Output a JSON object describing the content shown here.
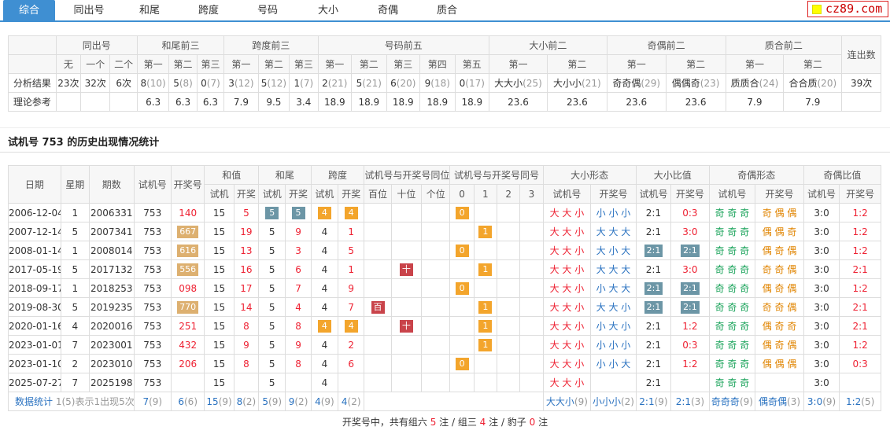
{
  "nav": {
    "tabs": [
      "综合",
      "同出号",
      "和尾",
      "跨度",
      "号码",
      "大小",
      "奇偶",
      "质合"
    ],
    "active": 0
  },
  "logo": "cz89.com",
  "top": {
    "groups": [
      "同出号",
      "和尾前三",
      "跨度前三",
      "号码前五",
      "大小前二",
      "奇偶前二",
      "质合前二",
      "连出数"
    ],
    "subheads": [
      "无",
      "一个",
      "二个",
      "第一",
      "第二",
      "第三",
      "第一",
      "第二",
      "第三",
      "第一",
      "第二",
      "第三",
      "第四",
      "第五",
      "第一",
      "第二",
      "第一",
      "第二",
      "第一",
      "第二"
    ],
    "row1_label": "分析结果",
    "row1": [
      [
        "23次",
        ""
      ],
      [
        "32次",
        ""
      ],
      [
        "6次",
        ""
      ],
      [
        "8",
        "(10)"
      ],
      [
        "5",
        "(8)"
      ],
      [
        "0",
        "(7)"
      ],
      [
        "3",
        "(12)"
      ],
      [
        "5",
        "(12)"
      ],
      [
        "1",
        "(7)"
      ],
      [
        "2",
        "(21)"
      ],
      [
        "5",
        "(21)"
      ],
      [
        "6",
        "(20)"
      ],
      [
        "9",
        "(18)"
      ],
      [
        "0",
        "(17)"
      ],
      [
        "大大小",
        "(25)"
      ],
      [
        "大小小",
        "(21)"
      ],
      [
        "奇奇偶",
        "(29)"
      ],
      [
        "偶偶奇",
        "(23)"
      ],
      [
        "质质合",
        "(24)"
      ],
      [
        "合合质",
        "(20)"
      ],
      [
        "39次",
        ""
      ]
    ],
    "row2_label": "理论参考",
    "row2": [
      "",
      "",
      "",
      "6.3",
      "6.3",
      "6.3",
      "7.9",
      "9.5",
      "3.4",
      "18.9",
      "18.9",
      "18.9",
      "18.9",
      "18.9",
      "23.6",
      "23.6",
      "23.6",
      "23.6",
      "7.9",
      "7.9",
      ""
    ]
  },
  "section_title": "试机号 753 的历史出现情况统计",
  "hist": {
    "h1": [
      "日期",
      "星期",
      "期数",
      "试机号",
      "开奖号",
      "和值",
      "和尾",
      "跨度",
      "试机号与开奖号同位",
      "试机号与开奖号同号",
      "大小形态",
      "大小比值",
      "奇偶形态",
      "奇偶比值"
    ],
    "h2": [
      "试机",
      "开奖",
      "试机",
      "开奖",
      "试机",
      "开奖",
      "百位",
      "十位",
      "个位",
      "0",
      "1",
      "2",
      "3",
      "试机号",
      "开奖号",
      "试机号",
      "开奖号",
      "试机号",
      "开奖号",
      "试机号",
      "开奖号"
    ],
    "rows": [
      {
        "date": "2006-12-04",
        "wk": "1",
        "qi": "2006331",
        "sj": "753",
        "kj": "140",
        "kjb": "",
        "hz1": "15",
        "hz2": "5",
        "hw1": "5",
        "hw1b": "g",
        "hw2": "5",
        "hw2b": "g",
        "kd1": "4",
        "kd1b": "o",
        "kd2": "4",
        "kd2b": "o",
        "tw": [
          "",
          "",
          ""
        ],
        "th": [
          "0",
          "",
          "",
          ""
        ],
        "dx1": "大 大 小",
        "dx2": "小 小 小",
        "db1": "2:1",
        "db1b": "",
        "db2": "0:3",
        "db2b": "",
        "jo1": "奇 奇 奇",
        "jo2": "奇 偶 偶",
        "jb1": "3:0",
        "jb2": "1:2"
      },
      {
        "date": "2007-12-14",
        "wk": "5",
        "qi": "2007341",
        "sj": "753",
        "kj": "667",
        "kjb": "t",
        "hz1": "15",
        "hz2": "19",
        "hw1": "5",
        "hw1b": "",
        "hw2": "9",
        "hw2b": "",
        "kd1": "4",
        "kd1b": "",
        "kd2": "1",
        "kd2b": "",
        "tw": [
          "",
          "",
          ""
        ],
        "th": [
          "",
          "1",
          "",
          ""
        ],
        "dx1": "大 大 小",
        "dx2": "大 大 大",
        "db1": "2:1",
        "db1b": "",
        "db2": "3:0",
        "db2b": "",
        "jo1": "奇 奇 奇",
        "jo2": "偶 偶 奇",
        "jb1": "3:0",
        "jb2": "1:2"
      },
      {
        "date": "2008-01-14",
        "wk": "1",
        "qi": "2008014",
        "sj": "753",
        "kj": "616",
        "kjb": "t",
        "hz1": "15",
        "hz2": "13",
        "hw1": "5",
        "hw1b": "",
        "hw2": "3",
        "hw2b": "",
        "kd1": "4",
        "kd1b": "",
        "kd2": "5",
        "kd2b": "",
        "tw": [
          "",
          "",
          ""
        ],
        "th": [
          "0",
          "",
          "",
          ""
        ],
        "dx1": "大 大 小",
        "dx2": "大 小 大",
        "db1": "2:1",
        "db1b": "g",
        "db2": "2:1",
        "db2b": "g",
        "jo1": "奇 奇 奇",
        "jo2": "偶 奇 偶",
        "jb1": "3:0",
        "jb2": "1:2"
      },
      {
        "date": "2017-05-19",
        "wk": "5",
        "qi": "2017132",
        "sj": "753",
        "kj": "556",
        "kjb": "t",
        "hz1": "15",
        "hz2": "16",
        "hw1": "5",
        "hw1b": "",
        "hw2": "6",
        "hw2b": "",
        "kd1": "4",
        "kd1b": "",
        "kd2": "1",
        "kd2b": "",
        "tw": [
          "",
          "十",
          ""
        ],
        "th": [
          "",
          "1",
          "",
          ""
        ],
        "dx1": "大 大 小",
        "dx2": "大 大 大",
        "db1": "2:1",
        "db1b": "",
        "db2": "3:0",
        "db2b": "",
        "jo1": "奇 奇 奇",
        "jo2": "奇 奇 偶",
        "jb1": "3:0",
        "jb2": "2:1"
      },
      {
        "date": "2018-09-17",
        "wk": "1",
        "qi": "2018253",
        "sj": "753",
        "kj": "098",
        "kjb": "",
        "hz1": "15",
        "hz2": "17",
        "hw1": "5",
        "hw1b": "",
        "hw2": "7",
        "hw2b": "",
        "kd1": "4",
        "kd1b": "",
        "kd2": "9",
        "kd2b": "",
        "tw": [
          "",
          "",
          ""
        ],
        "th": [
          "0",
          "",
          "",
          ""
        ],
        "dx1": "大 大 小",
        "dx2": "小 大 大",
        "db1": "2:1",
        "db1b": "g",
        "db2": "2:1",
        "db2b": "g",
        "jo1": "奇 奇 奇",
        "jo2": "偶 奇 偶",
        "jb1": "3:0",
        "jb2": "1:2"
      },
      {
        "date": "2019-08-30",
        "wk": "5",
        "qi": "2019235",
        "sj": "753",
        "kj": "770",
        "kjb": "t",
        "hz1": "15",
        "hz2": "14",
        "hw1": "5",
        "hw1b": "",
        "hw2": "4",
        "hw2b": "",
        "kd1": "4",
        "kd1b": "",
        "kd2": "7",
        "kd2b": "",
        "tw": [
          "百",
          "",
          ""
        ],
        "th": [
          "",
          "1",
          "",
          ""
        ],
        "dx1": "大 大 小",
        "dx2": "大 大 小",
        "db1": "2:1",
        "db1b": "g",
        "db2": "2:1",
        "db2b": "g",
        "jo1": "奇 奇 奇",
        "jo2": "奇 奇 偶",
        "jb1": "3:0",
        "jb2": "2:1"
      },
      {
        "date": "2020-01-16",
        "wk": "4",
        "qi": "2020016",
        "sj": "753",
        "kj": "251",
        "kjb": "",
        "hz1": "15",
        "hz2": "8",
        "hw1": "5",
        "hw1b": "",
        "hw2": "8",
        "hw2b": "",
        "kd1": "4",
        "kd1b": "o",
        "kd2": "4",
        "kd2b": "o",
        "tw": [
          "",
          "十",
          ""
        ],
        "th": [
          "",
          "1",
          "",
          ""
        ],
        "dx1": "大 大 小",
        "dx2": "小 大 小",
        "db1": "2:1",
        "db1b": "",
        "db2": "1:2",
        "db2b": "",
        "jo1": "奇 奇 奇",
        "jo2": "偶 奇 奇",
        "jb1": "3:0",
        "jb2": "2:1"
      },
      {
        "date": "2023-01-01",
        "wk": "7",
        "qi": "2023001",
        "sj": "753",
        "kj": "432",
        "kjb": "",
        "hz1": "15",
        "hz2": "9",
        "hw1": "5",
        "hw1b": "",
        "hw2": "9",
        "hw2b": "",
        "kd1": "4",
        "kd1b": "",
        "kd2": "2",
        "kd2b": "",
        "tw": [
          "",
          "",
          ""
        ],
        "th": [
          "",
          "1",
          "",
          ""
        ],
        "dx1": "大 大 小",
        "dx2": "小 小 小",
        "db1": "2:1",
        "db1b": "",
        "db2": "0:3",
        "db2b": "",
        "jo1": "奇 奇 奇",
        "jo2": "偶 奇 偶",
        "jb1": "3:0",
        "jb2": "1:2"
      },
      {
        "date": "2023-01-10",
        "wk": "2",
        "qi": "2023010",
        "sj": "753",
        "kj": "206",
        "kjb": "",
        "hz1": "15",
        "hz2": "8",
        "hw1": "5",
        "hw1b": "",
        "hw2": "8",
        "hw2b": "",
        "kd1": "4",
        "kd1b": "",
        "kd2": "6",
        "kd2b": "",
        "tw": [
          "",
          "",
          ""
        ],
        "th": [
          "0",
          "",
          "",
          ""
        ],
        "dx1": "大 大 小",
        "dx2": "小 小 大",
        "db1": "2:1",
        "db1b": "",
        "db2": "1:2",
        "db2b": "",
        "jo1": "奇 奇 奇",
        "jo2": "偶 偶 偶",
        "jb1": "3:0",
        "jb2": "0:3"
      },
      {
        "date": "2025-07-27",
        "wk": "7",
        "qi": "2025198",
        "sj": "753",
        "kj": "",
        "kjb": "",
        "hz1": "15",
        "hz2": "",
        "hw1": "5",
        "hw1b": "",
        "hw2": "",
        "hw2b": "",
        "kd1": "4",
        "kd1b": "",
        "kd2": "",
        "kd2b": "",
        "tw": [
          "",
          "",
          ""
        ],
        "th": [
          "",
          "",
          "",
          ""
        ],
        "dx1": "大 大 小",
        "dx2": "",
        "db1": "2:1",
        "db1b": "",
        "db2": "",
        "db2b": "",
        "jo1": "奇 奇 奇",
        "jo2": "",
        "jb1": "3:0",
        "jb2": ""
      }
    ],
    "sum": {
      "label": "数据统计",
      "note": "1(5)表示1出现5次",
      "cells": [
        [
          "7",
          "(9)"
        ],
        [
          "6",
          "(6)"
        ],
        [
          "15",
          "(9)"
        ],
        [
          "8",
          "(2)"
        ],
        [
          "5",
          "(9)"
        ],
        [
          "9",
          "(2)"
        ],
        [
          "4",
          "(9)"
        ],
        [
          "4",
          "(2)"
        ],
        [
          "大大小",
          "(9)"
        ],
        [
          "小小小",
          "(2)"
        ],
        [
          "2:1",
          "(9)"
        ],
        [
          "2:1",
          "(3)"
        ],
        [
          "奇奇奇",
          "(9)"
        ],
        [
          "偶奇偶",
          "(3)"
        ],
        [
          "3:0",
          "(9)"
        ],
        [
          "1:2",
          "(5)"
        ]
      ]
    }
  },
  "footer": {
    "pre": "开奖号中，共有组六 ",
    "n6": "5",
    "m1": " 注 / 组三 ",
    "n3": "4",
    "m2": " 注 / 豹子 ",
    "n0": "0",
    "post": " 注"
  }
}
